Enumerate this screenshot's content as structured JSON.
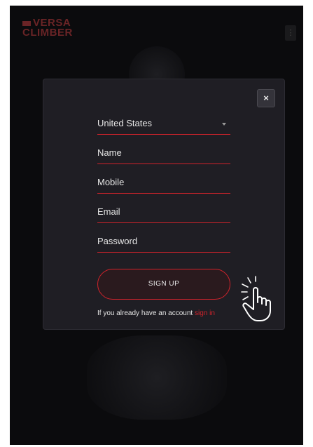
{
  "logo": {
    "line1": "VERSA",
    "line2": "CLIMBER"
  },
  "header": {
    "menu_icon": "menu-icon"
  },
  "modal": {
    "close_label": "×",
    "country": {
      "value": "United States"
    },
    "fields": {
      "name": "Name",
      "mobile": "Mobile",
      "email": "Email",
      "password": "Password"
    },
    "signup_label": "SIGN UP",
    "account_text": "If you already have an account",
    "signin_link": "sign in"
  },
  "colors": {
    "accent": "#d1232b",
    "modal_bg": "#1f1e24",
    "page_bg": "#0b0b0d"
  }
}
